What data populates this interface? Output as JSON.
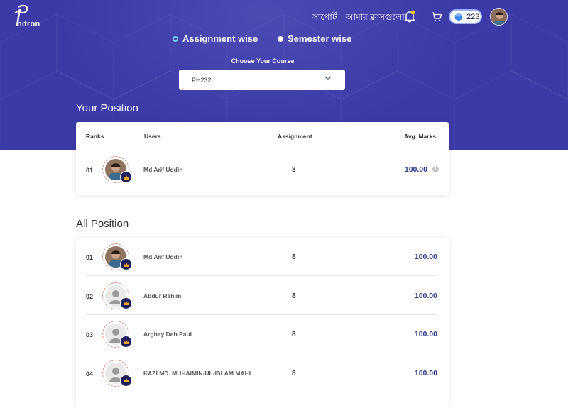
{
  "nav": {
    "logo_text": "hitron",
    "support_label": "সাপোর্ট",
    "classes_label": "আমার ক্লাসগুলো",
    "gem_count": "223",
    "icons": [
      "bell-icon",
      "cart-icon",
      "gem-icon"
    ]
  },
  "filters": {
    "assignment_wise": "Assignment wise",
    "semester_wise": "Semester wise",
    "selected": "assignment_wise"
  },
  "course": {
    "label": "Choose Your Course",
    "value": "PH232"
  },
  "your_position": {
    "title": "Your Position",
    "columns": [
      "Ranks",
      "Users",
      "Assignment",
      "Avg. Marks"
    ],
    "row": {
      "rank": "01",
      "name": "Md Arif Uddin",
      "assignment": "8",
      "avg": "100.00",
      "has_photo": true
    }
  },
  "all_position": {
    "title": "All Position",
    "rows": [
      {
        "rank": "01",
        "name": "Md Arif Uddin",
        "assignment": "8",
        "avg": "100.00",
        "has_photo": true
      },
      {
        "rank": "02",
        "name": "Abdur Rahim",
        "assignment": "8",
        "avg": "100.00",
        "has_photo": false
      },
      {
        "rank": "03",
        "name": "Arghay Deb Paul",
        "assignment": "8",
        "avg": "100.00",
        "has_photo": false
      },
      {
        "rank": "04",
        "name": "KAZI MD. MUHAIMIN-UL-ISLAM MAHI",
        "assignment": "8",
        "avg": "100.00",
        "has_photo": false
      }
    ]
  },
  "colors": {
    "hero_bg": "#3c3aa6",
    "accent_marks": "#2d3a8c",
    "crown_bg": "#1f1f5c",
    "crown_gold": "#f5a623"
  }
}
